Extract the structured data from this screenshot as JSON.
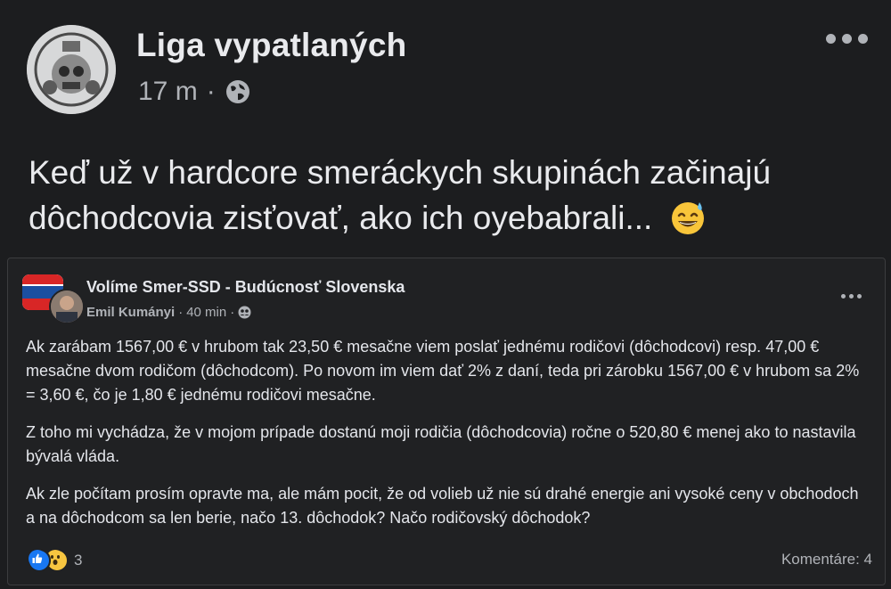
{
  "outer_post": {
    "page_name": "Liga vypatlaných",
    "time": "17 m",
    "separator": "·",
    "privacy_icon": "globe-icon",
    "text": "Keď už v hardcore smeráckych skupinách začinajú dôchodcovia zisťovať, ako ich oyebabrali...",
    "emoji": "grinning-sweat-emoji"
  },
  "shared_post": {
    "group_name": "Volíme Smer-SSD - Budúcnosť Slovenska",
    "author": "Emil Kumányi",
    "time": "40 min",
    "separator": "·",
    "audience_icon": "group-icon",
    "paragraphs": [
      "Ak zarábam 1567,00 € v hrubom tak 23,50 € mesačne viem poslať jednému rodičovi (dôchodcovi) resp. 47,00 € mesačne dvom rodičom (dôchodcom). Po novom im viem dať 2% z daní, teda pri zárobku 1567,00 € v hrubom sa 2% = 3,60 €, čo je 1,80 € jednému rodičovi mesačne.",
      "Z toho mi vychádza, že v mojom prípade dostanú moji rodičia (dôchodcovia) ročne o 520,80 € menej ako to nastavila bývalá vláda.",
      "Ak zle počítam prosím opravte ma, ale mám pocit, že od volieb už nie sú drahé energie ani vysoké ceny v obchodoch a na dôchodcom sa len berie, načo 13. dôchodok? Načo rodičovský dôchodok?"
    ],
    "reaction_count": "3",
    "comments_label": "Komentáre: 4"
  },
  "colors": {
    "background": "#1c1d1f",
    "card": "#202123",
    "text_primary": "#e4e6eb",
    "text_secondary": "#b0b3b8",
    "like_blue": "#1877f2",
    "wow_yellow": "#f7c540"
  }
}
